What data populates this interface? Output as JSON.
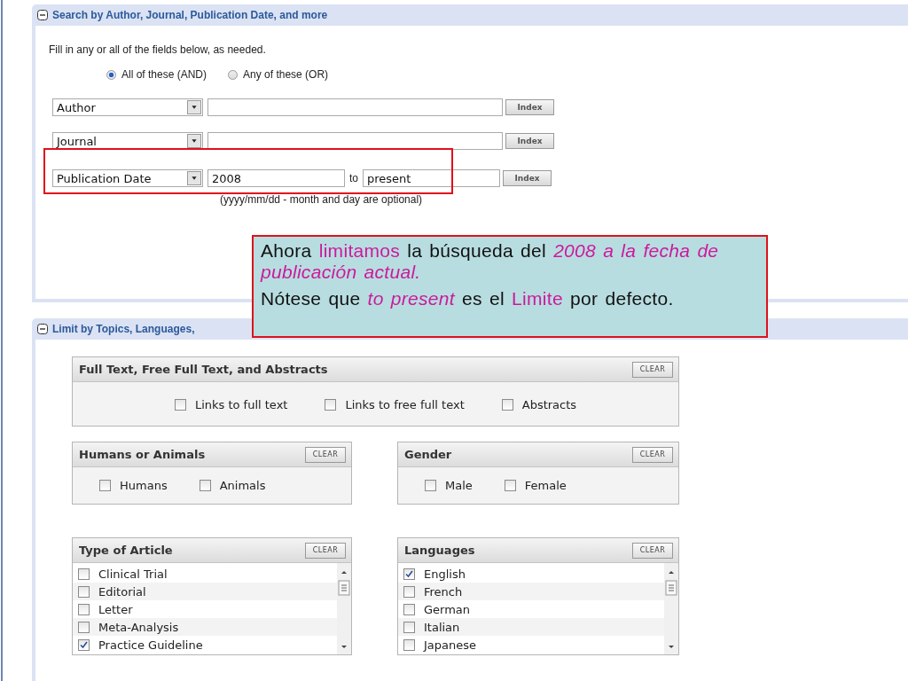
{
  "search_section": {
    "title": "Search by Author, Journal, Publication Date, and more",
    "expanded": true,
    "instructions": "Fill in any or all of the fields below, as needed.",
    "match_options": [
      {
        "label": "All of these (AND)",
        "selected": true
      },
      {
        "label": "Any of these (OR)",
        "selected": false
      }
    ],
    "rows": [
      {
        "field": "Author",
        "button": "Index",
        "highlighted": false
      },
      {
        "field": "Journal",
        "button": "Index",
        "highlighted": false
      },
      {
        "field": "Publication Date",
        "value": "2008",
        "range_label": "to",
        "range_value": "present",
        "hint": "(yyyy/mm/dd - month and day are optional)",
        "button": "Index",
        "highlighted": true
      }
    ]
  },
  "limit_section": {
    "title": "Limit by Topics, Languages,",
    "expanded": true,
    "filters": [
      {
        "title": "Full Text, Free Full Text, and Abstracts",
        "clear_label": "CLEAR",
        "kind": "wide",
        "options": [
          {
            "label": "Links to full text",
            "checked": false
          },
          {
            "label": "Links to free full text",
            "checked": false
          },
          {
            "label": "Abstracts",
            "checked": false
          }
        ]
      },
      {
        "title": "Humans or Animals",
        "clear_label": "CLEAR",
        "kind": "inline",
        "options": [
          {
            "label": "Humans",
            "checked": false
          },
          {
            "label": "Animals",
            "checked": false
          }
        ]
      },
      {
        "title": "Gender",
        "clear_label": "CLEAR",
        "kind": "inline",
        "options": [
          {
            "label": "Male",
            "checked": false
          },
          {
            "label": "Female",
            "checked": false
          }
        ]
      },
      {
        "title": "Type of Article",
        "clear_label": "CLEAR",
        "kind": "list",
        "options": [
          {
            "label": "Clinical Trial",
            "checked": false
          },
          {
            "label": "Editorial",
            "checked": false
          },
          {
            "label": "Letter",
            "checked": false
          },
          {
            "label": "Meta-Analysis",
            "checked": false
          },
          {
            "label": "Practice Guideline",
            "checked": true
          }
        ]
      },
      {
        "title": "Languages",
        "clear_label": "CLEAR",
        "kind": "list",
        "options": [
          {
            "label": "English",
            "checked": true
          },
          {
            "label": "French",
            "checked": false
          },
          {
            "label": "German",
            "checked": false
          },
          {
            "label": "Italian",
            "checked": false
          },
          {
            "label": "Japanese",
            "checked": false
          }
        ]
      }
    ]
  },
  "callout": {
    "paragraphs": [
      [
        {
          "text": "Ahora ",
          "kind": "plain"
        },
        {
          "text": "limitamos",
          "kind": "keyword"
        },
        {
          "text": " la búsqueda del ",
          "kind": "plain"
        },
        {
          "text": "2008 a la fecha de publicación actual.",
          "kind": "emphasis"
        }
      ],
      [
        {
          "text": "Nótese que ",
          "kind": "plain"
        },
        {
          "text": "to present",
          "kind": "emphasis"
        },
        {
          "text": " es el ",
          "kind": "plain"
        },
        {
          "text": "Limite",
          "kind": "keyword"
        },
        {
          "text": " por defecto.",
          "kind": "plain"
        }
      ]
    ]
  }
}
